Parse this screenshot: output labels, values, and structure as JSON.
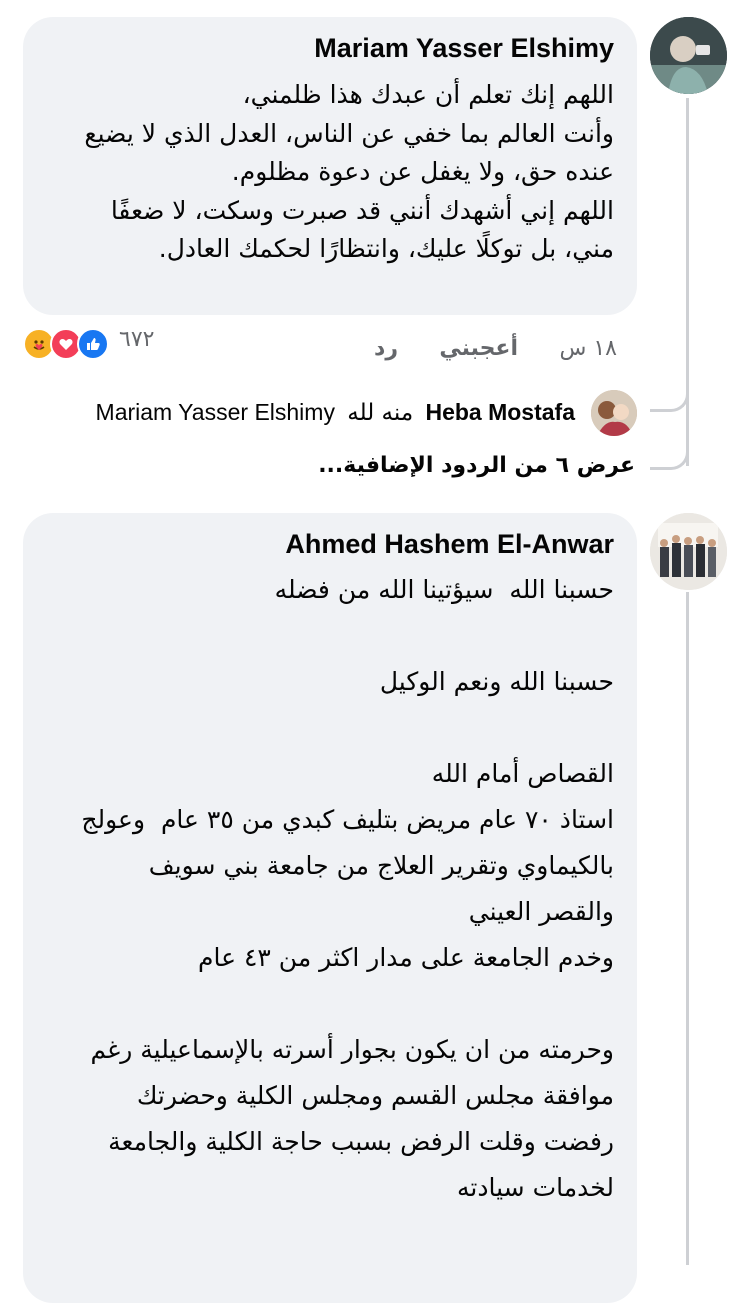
{
  "comment1": {
    "author": "Mariam Yasser Elshimy",
    "text": "اللهم إنك تعلم أن عبدك هذا ظلمني،\nوأنت العالم بما خفي عن الناس، العدل الذي لا يضيع\nعنده حق، ولا يغفل عن دعوة مظلوم.\nاللهم إني أشهدك أنني قد صبرت وسكت، لا ضعفًا\nمني، بل توكلًا عليك، وانتظارًا لحكمك العادل.",
    "time": "١٨ س",
    "like_label": "أعجبني",
    "reply_label": "رد",
    "reaction_count": "٦٧٢",
    "reactions": [
      "like-icon",
      "love-icon",
      "care-icon"
    ]
  },
  "reply": {
    "author": "Heba Mostafa",
    "text": "منه لله",
    "mention": "Mariam Yasser Elshimy",
    "more_replies": "عرض ٦ من الردود الإضافية..."
  },
  "comment2": {
    "author": "Ahmed Hashem El-Anwar",
    "text": "حسبنا الله  سيؤتينا الله من فضله\n\nحسبنا الله ونعم الوكيل\n\nالقصاص أمام الله\nاستاذ ٧٠ عام مريض بتليف كبدي من ٣٥ عام  وعولج\nبالكيماوي وتقرير العلاج من جامعة بني سويف\nوالقصر العيني\nوخدم الجامعة على مدار اكثر من ٤٣ عام\n\nوحرمته من ان يكون بجوار أسرته بالإسماعيلية رغم\nموافقة مجلس القسم ومجلس الكلية وحضرتك\nرفضت وقلت الرفض بسبب حاجة الكلية والجامعة\nلخدمات سيادته"
  },
  "colors": {
    "bubble": "#f0f2f5",
    "like_blue": "#1877f2",
    "love_red": "#f33e58",
    "care_yellow": "#f7b125",
    "secondary_text": "#65676b"
  }
}
